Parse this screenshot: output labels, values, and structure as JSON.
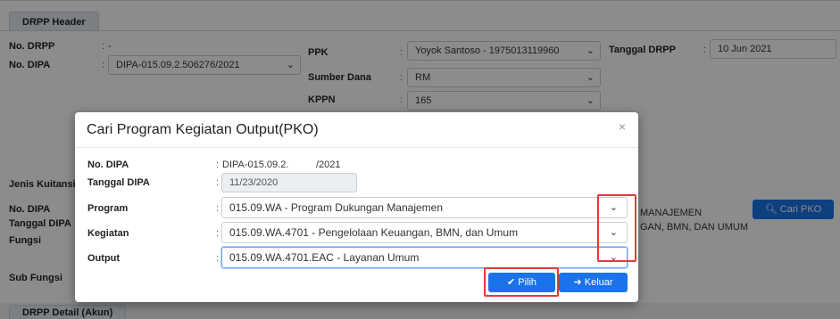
{
  "background": {
    "header_tab": "DRPP Header",
    "no_drpp": {
      "label": "No. DRPP",
      "value": "-"
    },
    "no_dipa": {
      "label": "No. DIPA",
      "value": "DIPA-015.09.2.506276/2021"
    },
    "ppk": {
      "label": "PPK",
      "value": "Yoyok Santoso - 1975013119960"
    },
    "tanggal_drpp": {
      "label": "Tanggal DRPP",
      "value": "10 Jun 2021"
    },
    "sumber_dana": {
      "label": "Sumber Dana",
      "value": "RM"
    },
    "kppn": {
      "label": "KPPN",
      "value": "165"
    },
    "jenis_kuitansi_label": "Jenis Kuitansi",
    "no_dipa2_label": "No. DIPA",
    "tanggal_dipa_label": "Tanggal DIPA",
    "fungsi_label": "Fungsi",
    "sub_fungsi_label": "Sub Fungsi",
    "program_partial": "MANAJEMEN",
    "kegiatan_partial": "GAN, BMN, DAN UMUM",
    "cari_pko_button": "Cari PKO",
    "detail_tab": "DRPP Detail (Akun)"
  },
  "modal": {
    "title": "Cari Program Kegiatan Output(PKO)",
    "close": "×",
    "no_dipa": {
      "label": "No. DIPA",
      "value": "DIPA-015.09.2.          /2021"
    },
    "tanggal_dipa": {
      "label": "Tanggal DIPA",
      "value": "11/23/2020"
    },
    "program": {
      "label": "Program",
      "value": "015.09.WA - Program Dukungan Manajemen"
    },
    "kegiatan": {
      "label": "Kegiatan",
      "value": "015.09.WA.4701 - Pengelolaan Keuangan, BMN, dan Umum"
    },
    "output": {
      "label": "Output",
      "value": "015.09.WA.4701.EAC - Layanan Umum"
    },
    "pilih_button": "Pilih",
    "keluar_button": "Keluar"
  },
  "colon": ":",
  "colors": {
    "primary": "#1a73e8",
    "highlight": "#e53935"
  }
}
